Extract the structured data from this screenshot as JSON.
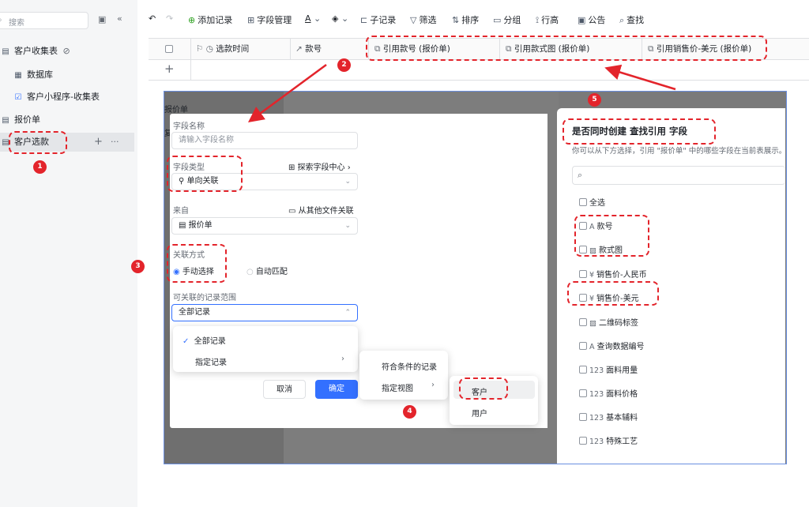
{
  "sidebar": {
    "search_placeholder": "搜索",
    "items": [
      {
        "label": "客户收集表"
      },
      {
        "label": "数据库"
      },
      {
        "label": "客户小程序-收集表"
      },
      {
        "label": "报价单"
      },
      {
        "label": "客户选款"
      }
    ]
  },
  "toolbar": {
    "add_record": "添加记录",
    "field_manage": "字段管理",
    "sub_record": "子记录",
    "filter": "筛选",
    "sort": "排序",
    "group": "分组",
    "row_height": "行高",
    "notice": "公告",
    "find": "查找"
  },
  "table": {
    "columns": [
      "选款时间",
      "款号",
      "引用款号 (报价单)",
      "引用款式图 (报价单)",
      "引用销售价-美元 (报价单)"
    ],
    "add_row": "+"
  },
  "embed": {
    "bg_title": "报价单",
    "bg_char": "复"
  },
  "modal": {
    "field_name_label": "字段名称",
    "field_name_placeholder": "请输入字段名称",
    "field_type_label": "字段类型",
    "explore_link": "探索字段中心",
    "field_type_value": "单向关联",
    "from_label": "来自",
    "from_other_link": "从其他文件关联",
    "from_value": "报价单",
    "link_mode_label": "关联方式",
    "mode_manual": "手动选择",
    "mode_auto": "自动匹配",
    "range_label": "可关联的记录范围",
    "range_value": "全部记录",
    "menu_all": "全部记录",
    "menu_specified": "指定记录",
    "cancel": "取消",
    "ok": "确定"
  },
  "submenu": {
    "match_conditions": "符合条件的记录",
    "specified_view": "指定视图"
  },
  "submenu2": {
    "customer": "客户",
    "user": "用户"
  },
  "rpanel": {
    "title": "是否同时创建 查找引用 字段",
    "desc": "你可以从下方选择，引用 \"报价单\" 中的哪些字段在当前表展示。",
    "select_all": "全选",
    "items": [
      {
        "type": "A",
        "label": "款号"
      },
      {
        "type": "img",
        "label": "款式图"
      },
      {
        "type": "¥",
        "label": "销售价-人民币"
      },
      {
        "type": "¥",
        "label": "销售价-美元"
      },
      {
        "type": "img",
        "label": "二维码标签"
      },
      {
        "type": "A",
        "label": "查询数据编号"
      },
      {
        "type": "123",
        "label": "面料用量"
      },
      {
        "type": "123",
        "label": "面料价格"
      },
      {
        "type": "123",
        "label": "基本辅料"
      },
      {
        "type": "123",
        "label": "特殊工艺"
      }
    ]
  },
  "badges": [
    "1",
    "2",
    "3",
    "4",
    "5"
  ],
  "colors": {
    "annotation": "#e3242b",
    "primary": "#3370ff"
  }
}
